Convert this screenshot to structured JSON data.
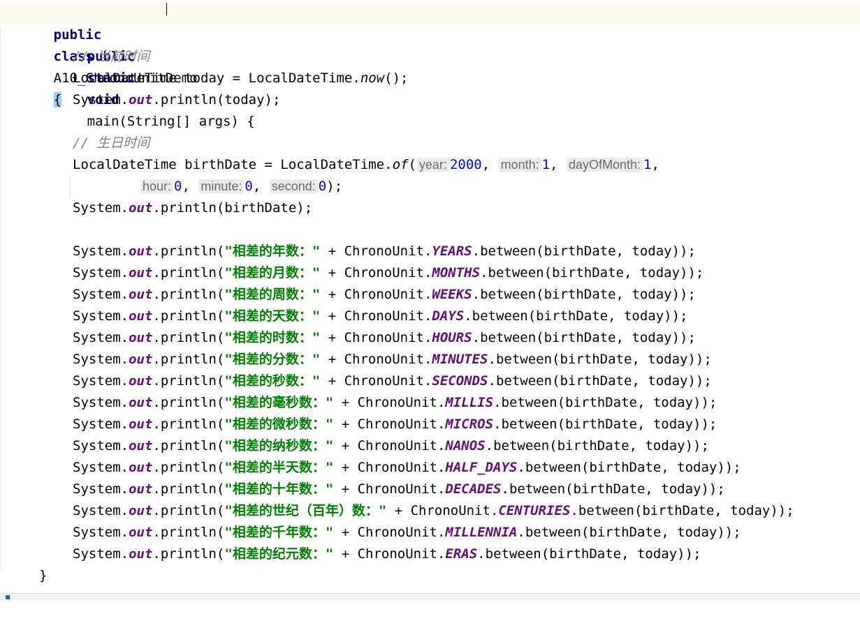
{
  "editor": {
    "class_decl": {
      "kw1": "public",
      "kw2": "class",
      "name": "A10_ChronoUnitDemo",
      "brace": "{"
    },
    "main_decl": {
      "kw1": "public",
      "kw2": "static",
      "kw3": "void",
      "rest": "main(String[] args) {"
    },
    "comment_now": "// 当前时间",
    "line_today": {
      "pre": "LocalDateTime today = LocalDateTime.",
      "method": "now",
      "post": "();"
    },
    "print_today": "(today);",
    "comment_birth": "// 生日时间",
    "line_birth": {
      "pre": "LocalDateTime birthDate = LocalDateTime.",
      "method": "of",
      "open": "(",
      "hint_year": "year:",
      "year": "2000",
      "hint_month": "month:",
      "month": "1",
      "hint_day": "dayOfMonth:",
      "day": "1",
      "hint_hour": "hour:",
      "hour": "0",
      "hint_minute": "minute:",
      "minute": "0",
      "hint_second": "second:",
      "second": "0",
      "close": ");"
    },
    "print_birth": "(birthDate);",
    "sys": "System.",
    "out": "out",
    "println": ".println",
    "print_open": "(",
    "plus_cu": " + ChronoUnit.",
    "between": ".between(birthDate, today));",
    "diff_lines": [
      {
        "label": "\"相差的年数：\"",
        "unit": "YEARS"
      },
      {
        "label": "\"相差的月数：\"",
        "unit": "MONTHS"
      },
      {
        "label": "\"相差的周数：\"",
        "unit": "WEEKS"
      },
      {
        "label": "\"相差的天数：\"",
        "unit": "DAYS"
      },
      {
        "label": "\"相差的时数：\"",
        "unit": "HOURS"
      },
      {
        "label": "\"相差的分数：\"",
        "unit": "MINUTES"
      },
      {
        "label": "\"相差的秒数：\"",
        "unit": "SECONDS"
      },
      {
        "label": "\"相差的毫秒数：\"",
        "unit": "MILLIS"
      },
      {
        "label": "\"相差的微秒数：\"",
        "unit": "MICROS"
      },
      {
        "label": "\"相差的纳秒数：\"",
        "unit": "NANOS"
      },
      {
        "label": "\"相差的半天数：\"",
        "unit": "HALF_DAYS"
      },
      {
        "label": "\"相差的十年数：\"",
        "unit": "DECADES"
      },
      {
        "label": "\"相差的世纪（百年）数：\"",
        "unit": "CENTURIES"
      },
      {
        "label": "\"相差的千年数：\"",
        "unit": "MILLENNIA"
      },
      {
        "label": "\"相差的纪元数：\"",
        "unit": "ERAS"
      }
    ],
    "close_main": "}"
  },
  "colors": {
    "keyword": "#000080",
    "string": "#008000",
    "static_field": "#660e7a",
    "number": "#0000ff",
    "comment": "#808080",
    "current_line": "#fcfaed"
  }
}
